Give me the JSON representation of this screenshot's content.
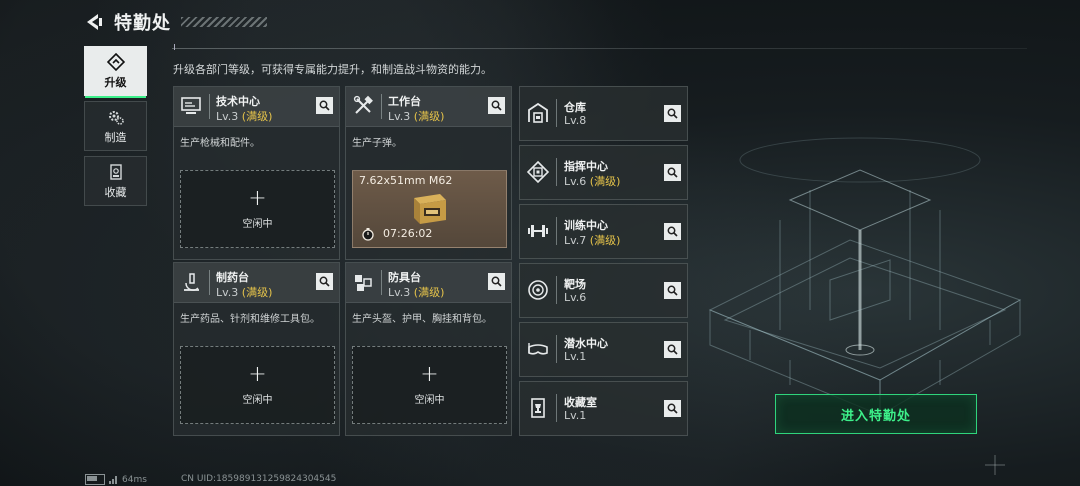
{
  "header": {
    "title": "特勤处"
  },
  "description": "升级各部门等级，可获得专属能力提升，和制造战斗物资的能力。",
  "sidebar": {
    "tabs": [
      {
        "label": "升级",
        "icon": "upgrade-icon",
        "active": true
      },
      {
        "label": "制造",
        "icon": "gears-icon",
        "active": false
      },
      {
        "label": "收藏",
        "icon": "collection-icon",
        "active": false
      }
    ]
  },
  "workstations": [
    {
      "name": "技术中心",
      "level": "Lv.3",
      "status": "(满级)",
      "desc": "生产枪械和配件。",
      "slot": "空闲中",
      "icon": "monitor-icon"
    },
    {
      "name": "工作台",
      "level": "Lv.3",
      "status": "(满级)",
      "desc": "生产子弹。",
      "icon": "tools-icon",
      "production": {
        "item": "7.62x51mm M62",
        "time": "07:26:02"
      }
    },
    {
      "name": "制药台",
      "level": "Lv.3",
      "status": "(满级)",
      "desc": "生产药品、针剂和维修工具包。",
      "slot": "空闲中",
      "icon": "microscope-icon"
    },
    {
      "name": "防具台",
      "level": "Lv.3",
      "status": "(满级)",
      "desc": "生产头盔、护甲、胸挂和背包。",
      "slot": "空闲中",
      "icon": "cubes-icon"
    }
  ],
  "facilities": [
    {
      "name": "仓库",
      "level": "Lv.8",
      "status": "",
      "icon": "warehouse-icon"
    },
    {
      "name": "指挥中心",
      "level": "Lv.6",
      "status": "(满级)",
      "icon": "chip-icon"
    },
    {
      "name": "训练中心",
      "level": "Lv.7",
      "status": "(满级)",
      "icon": "dumbbell-icon"
    },
    {
      "name": "靶场",
      "level": "Lv.6",
      "status": "",
      "icon": "target-icon"
    },
    {
      "name": "潜水中心",
      "level": "Lv.1",
      "status": "",
      "icon": "diving-mask-icon"
    },
    {
      "name": "收藏室",
      "level": "Lv.1",
      "status": "",
      "icon": "trophy-icon"
    }
  ],
  "enter_button": "进入特勤处",
  "footer": {
    "ping": "64ms",
    "uid": "CN UID:1859891312598243045​45"
  },
  "colors": {
    "accent_green": "#3df08a",
    "maxed_gold": "#e5c34a"
  }
}
